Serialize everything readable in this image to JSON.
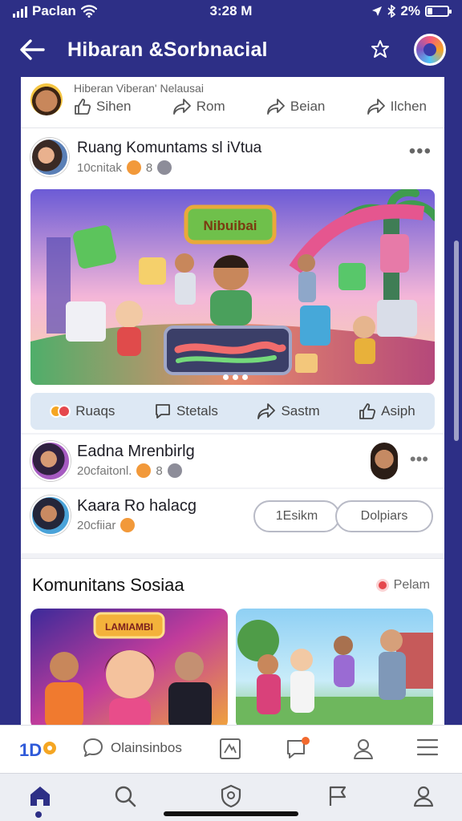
{
  "status_bar": {
    "carrier": "Paclan",
    "time": "3:28 M",
    "battery": "2%"
  },
  "header": {
    "title": "Hibaran &Sorbnacial"
  },
  "snippet": {
    "text": "Hiberan Viberan' Nelausai",
    "actions": [
      "Sihen",
      "Rom",
      "Beian",
      "Ilchen"
    ]
  },
  "post": {
    "name": "Ruang Komuntams sl iVtua",
    "meta": "10cnitak",
    "count": "8",
    "banner_text": "Nibuibai",
    "actions": [
      "Ruaqs",
      "Stetals",
      "Sastm",
      "Asiph"
    ]
  },
  "rows": [
    {
      "name": "Eadna Mrenbirlg",
      "meta": "20cfaitonl.",
      "count": "8"
    },
    {
      "name": "Kaara Ro halacg",
      "meta": "20cfiiar",
      "buttons": [
        "1Esikm",
        "Dolpiars"
      ]
    }
  ],
  "community": {
    "title": "Komunitans Sosiaa",
    "link": "Pelam",
    "card1_banner": "LAMIAMBI"
  },
  "tabbar_top": {
    "chat_label": "Olainsinbos"
  },
  "colors": {
    "brand": "#2d2f86",
    "accent": "#f2993a",
    "action_bg": "#dde8f4"
  }
}
